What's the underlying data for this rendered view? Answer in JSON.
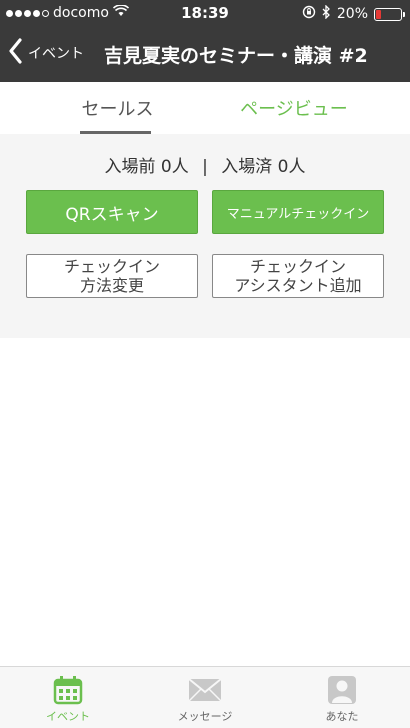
{
  "status_bar": {
    "carrier": "docomo",
    "time": "18:39",
    "battery_percent": "20%",
    "battery_level": 0.2,
    "icons": [
      "signal-dots",
      "wifi-icon",
      "orientation-lock-icon",
      "bluetooth-icon",
      "battery-icon"
    ]
  },
  "nav": {
    "back_label": "イベント",
    "title": "吉見夏実のセミナー・講演 #2"
  },
  "tabs": [
    {
      "label": "セールス",
      "active": true
    },
    {
      "label": "ページビュー",
      "active": false
    }
  ],
  "counts": {
    "before_label": "入場前",
    "before_value": "0人",
    "separator": "|",
    "after_label": "入場済",
    "after_value": "0人"
  },
  "buttons": {
    "qr_scan": "QRスキャン",
    "manual_checkin": "マニュアルチェックイン",
    "method_line1": "チェックイン",
    "method_line2": "方法変更",
    "assistant_line1": "チェックイン",
    "assistant_line2": "アシスタント追加"
  },
  "tab_bar": [
    {
      "label": "イベント",
      "icon": "calendar-icon",
      "active": true
    },
    {
      "label": "メッセージ",
      "icon": "envelope-icon",
      "active": false
    },
    {
      "label": "あなた",
      "icon": "user-icon",
      "active": false
    }
  ],
  "colors": {
    "header_bg": "#3a3a3a",
    "accent_green": "#6bbf4e",
    "battery_red": "#e53935"
  }
}
